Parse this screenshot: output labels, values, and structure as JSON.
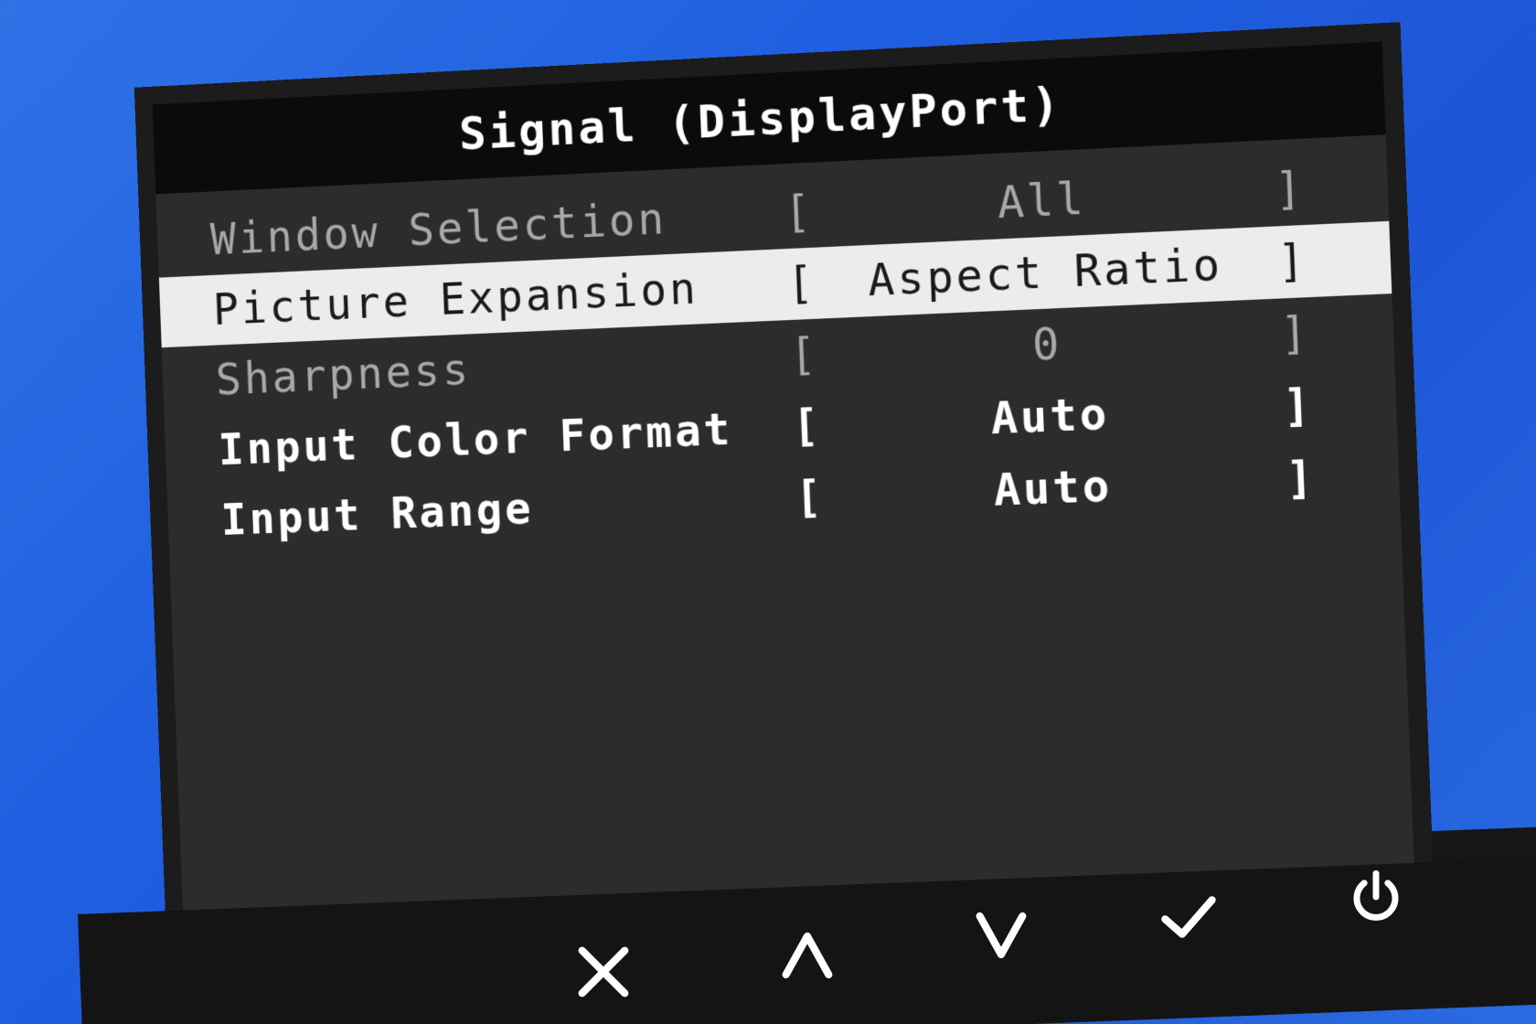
{
  "osd": {
    "title": "Signal (DisplayPort)",
    "menu": [
      {
        "label": "Window Selection",
        "value": "All",
        "state": "dim"
      },
      {
        "label": "Picture Expansion",
        "value": "Aspect Ratio",
        "state": "selected"
      },
      {
        "label": "Sharpness",
        "value": "0",
        "state": "dim"
      },
      {
        "label": "Input Color Format",
        "value": "Auto",
        "state": "normal"
      },
      {
        "label": "Input Range",
        "value": "Auto",
        "state": "normal"
      }
    ],
    "bracket_open": "[",
    "bracket_close": "]"
  },
  "buttons": [
    {
      "icon": "close-icon"
    },
    {
      "icon": "chevron-up-icon"
    },
    {
      "icon": "chevron-down-icon"
    },
    {
      "icon": "checkmark-icon"
    },
    {
      "icon": "power-icon"
    }
  ],
  "colors": {
    "background": "#1f5fe0",
    "panel": "#2c2c2c",
    "title_bar": "#0b0b0b",
    "selected_row": "#ececec",
    "dim_text": "#a8a8a8"
  }
}
